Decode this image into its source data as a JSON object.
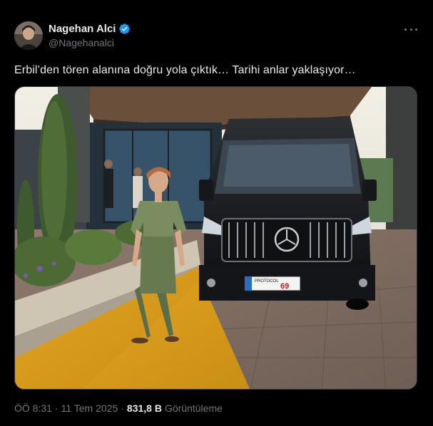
{
  "author": {
    "display_name": "Nagehan Alci",
    "handle": "@Nagehanalci",
    "verified": true,
    "verified_color": "#1d9bf0"
  },
  "tweet": {
    "text": "Erbil’den tören alanına doğru yola çıktık… Tarihi anlar yaklaşıyor…"
  },
  "media": {
    "description_icon": "photo",
    "plate_text": "69",
    "plate_small": "PROTOCOL"
  },
  "meta": {
    "time": "ÖÖ 8:31",
    "separator": "·",
    "date": "11 Tem 2025",
    "views_count": "831,8 B",
    "views_label": "Görüntüleme"
  },
  "icons": {
    "more": "more-horizontal-icon",
    "verified": "verified-badge-icon"
  },
  "colors": {
    "background": "#000000",
    "text_primary": "#e7e9ea",
    "text_secondary": "#71767b",
    "border": "#2f3336"
  }
}
